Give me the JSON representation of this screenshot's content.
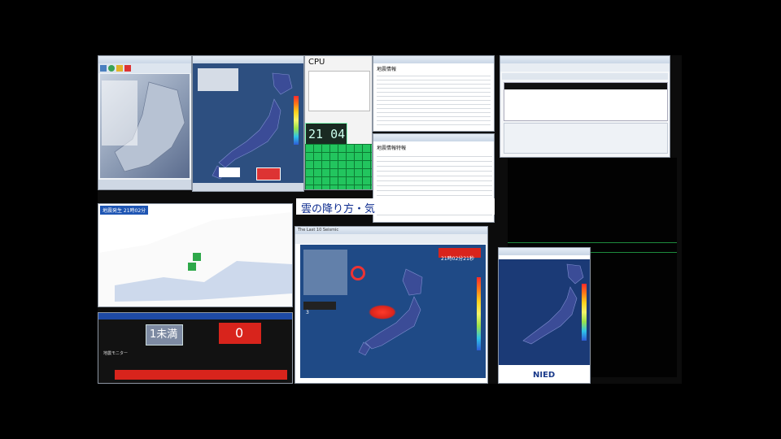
{
  "colors": {
    "background": "#000000",
    "accent_red": "#d8241c",
    "map_sea": "#2d4f80",
    "land_blue": "#3b4c97",
    "grid_green": "#19b84c"
  },
  "cpu_window": {
    "title": "CPU",
    "clock": "21 04"
  },
  "ticker_window": {
    "text": "雲の降り方・気"
  },
  "quake_news": {
    "title": "地震情報",
    "status_label": "地震発生 21時02分"
  },
  "tsunami_panel": {
    "title": "地震情報特報"
  },
  "last10_window": {
    "title": "The Last 10 Seismic",
    "time_badge": "21時02分21秒",
    "brand": "NIED"
  },
  "shake_panel": {
    "intensity_label": "1未満",
    "count": "0"
  },
  "status": {
    "level": "3",
    "monitor_label": "地震モニター"
  },
  "icons": [
    "map-icon",
    "clock-icon",
    "refresh-icon",
    "close-icon",
    "warning-icon",
    "signal-icon"
  ]
}
